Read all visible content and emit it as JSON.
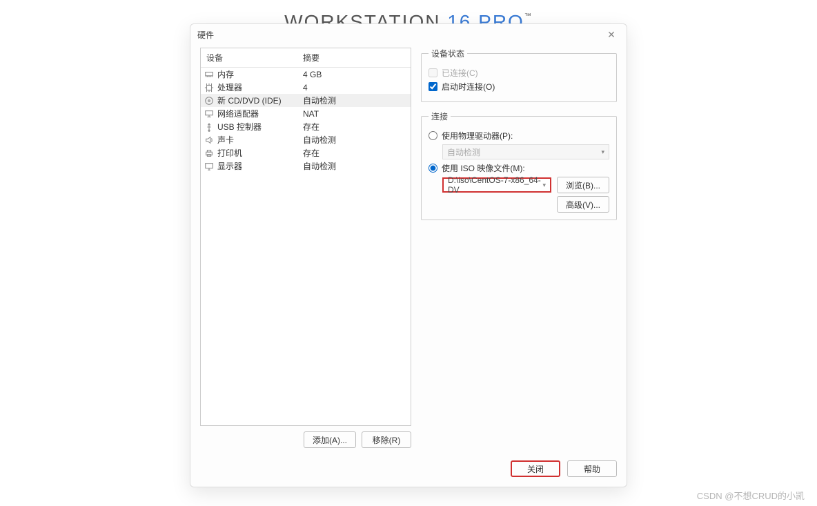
{
  "bg_title": {
    "a": "WORKSTATION ",
    "b": "16 PRO",
    "tm": "™"
  },
  "dialog": {
    "title": "硬件",
    "close_glyph": "✕"
  },
  "device_table": {
    "headers": {
      "device": "设备",
      "summary": "摘要"
    },
    "rows": [
      {
        "icon": "memory-icon",
        "name": "内存",
        "summary": "4 GB",
        "selected": false
      },
      {
        "icon": "cpu-icon",
        "name": "处理器",
        "summary": "4",
        "selected": false
      },
      {
        "icon": "disc-icon",
        "name": "新 CD/DVD (IDE)",
        "summary": "自动检测",
        "selected": true
      },
      {
        "icon": "network-icon",
        "name": "网络适配器",
        "summary": "NAT",
        "selected": false
      },
      {
        "icon": "usb-icon",
        "name": "USB 控制器",
        "summary": "存在",
        "selected": false
      },
      {
        "icon": "sound-icon",
        "name": "声卡",
        "summary": "自动检测",
        "selected": false
      },
      {
        "icon": "printer-icon",
        "name": "打印机",
        "summary": "存在",
        "selected": false
      },
      {
        "icon": "display-icon",
        "name": "显示器",
        "summary": "自动检测",
        "selected": false
      }
    ]
  },
  "left_buttons": {
    "add": "添加(A)...",
    "remove": "移除(R)"
  },
  "right": {
    "status": {
      "legend": "设备状态",
      "connected": "已连接(C)",
      "connect_on_power": "启动时连接(O)"
    },
    "connection": {
      "legend": "连接",
      "physical": "使用物理驱动器(P):",
      "physical_value": "自动检测",
      "iso": "使用 ISO 映像文件(M):",
      "iso_value": "D:\\iso\\CentOS-7-x86_64-DV",
      "browse": "浏览(B)...",
      "advanced": "高级(V)..."
    }
  },
  "footer": {
    "close": "关闭",
    "help": "帮助"
  },
  "watermark": "CSDN @不想CRUD的小凯"
}
